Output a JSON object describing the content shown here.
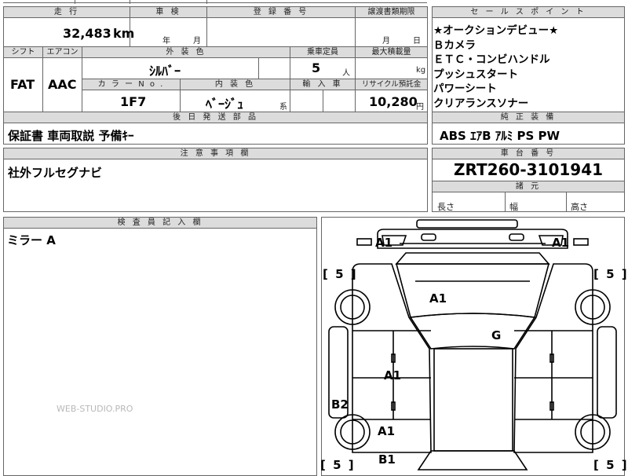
{
  "headers": {
    "mileage": "走 行",
    "inspection": "車 検",
    "registration": "登 録 番 号",
    "transfer_deadline": "譲渡書類期限",
    "selling_points": "セ ー ル ス ポ イ ン ト",
    "shift": "シフト",
    "aircon": "エアコン",
    "exterior_color": "外 装 色",
    "capacity": "乗車定員",
    "max_load": "最大積載量",
    "color_no": "カ ラ ー N o .",
    "interior_color": "内 装 色",
    "import": "輸 入 車",
    "recycle": "リサイクル預託金",
    "later_parts": "後 日 発 送 部 品",
    "genuine_equipment": "純 正 装 備",
    "notes": "注 意 事 項 欄",
    "chassis_no": "車 台 番 号",
    "dimensions": "諸 元",
    "inspector": "検 査 員 記 入 欄"
  },
  "values": {
    "mileage": "32,483",
    "mileage_unit": "km",
    "year_unit": "年",
    "month_unit": "月",
    "deadline_month": "月",
    "deadline_day": "日",
    "shift": "FAT",
    "aircon": "AAC",
    "exterior_color": "ｼﾙﾊﾞｰ",
    "capacity": "5",
    "capacity_unit": "人",
    "load_unit": "kg",
    "color_no": "1F7",
    "interior_color": "ﾍﾞｰｼﾞｭ",
    "interior_suffix": "系",
    "recycle_fee": "10,280",
    "recycle_unit": "円",
    "later_parts": "保証書  車両取説  予備ｷｰ",
    "genuine_equipment": "ABS  ｴｱB  ｱﾙﾐ  PS  PW",
    "notes": "社外フルセグナビ",
    "chassis_no": "ZRT260-3101941",
    "length_label": "長さ",
    "width_label": "幅",
    "height_label": "高さ",
    "inspector_note": "ミラー A"
  },
  "selling_points": [
    "★オークションデビュー★",
    "Ｂカメラ",
    "ＥＴＣ・コンビハンドル",
    "プッシュスタート",
    "パワーシート",
    "クリアランスソナー"
  ],
  "damage_marks": {
    "front_left": "A1",
    "front_right": "A1",
    "hood": "A1",
    "windshield": "G",
    "left_door": "A1",
    "left_rear_fender": "B2",
    "left_rear": "A1",
    "rear_left": "B1",
    "bracket_left_top": "[ 5 ]",
    "bracket_right_top": "[ 5 ]",
    "bracket_left_bottom": "[ 5 ]",
    "bracket_right_bottom": "[ 5 ]"
  },
  "watermark": "WEB-STUDIO.PRO"
}
